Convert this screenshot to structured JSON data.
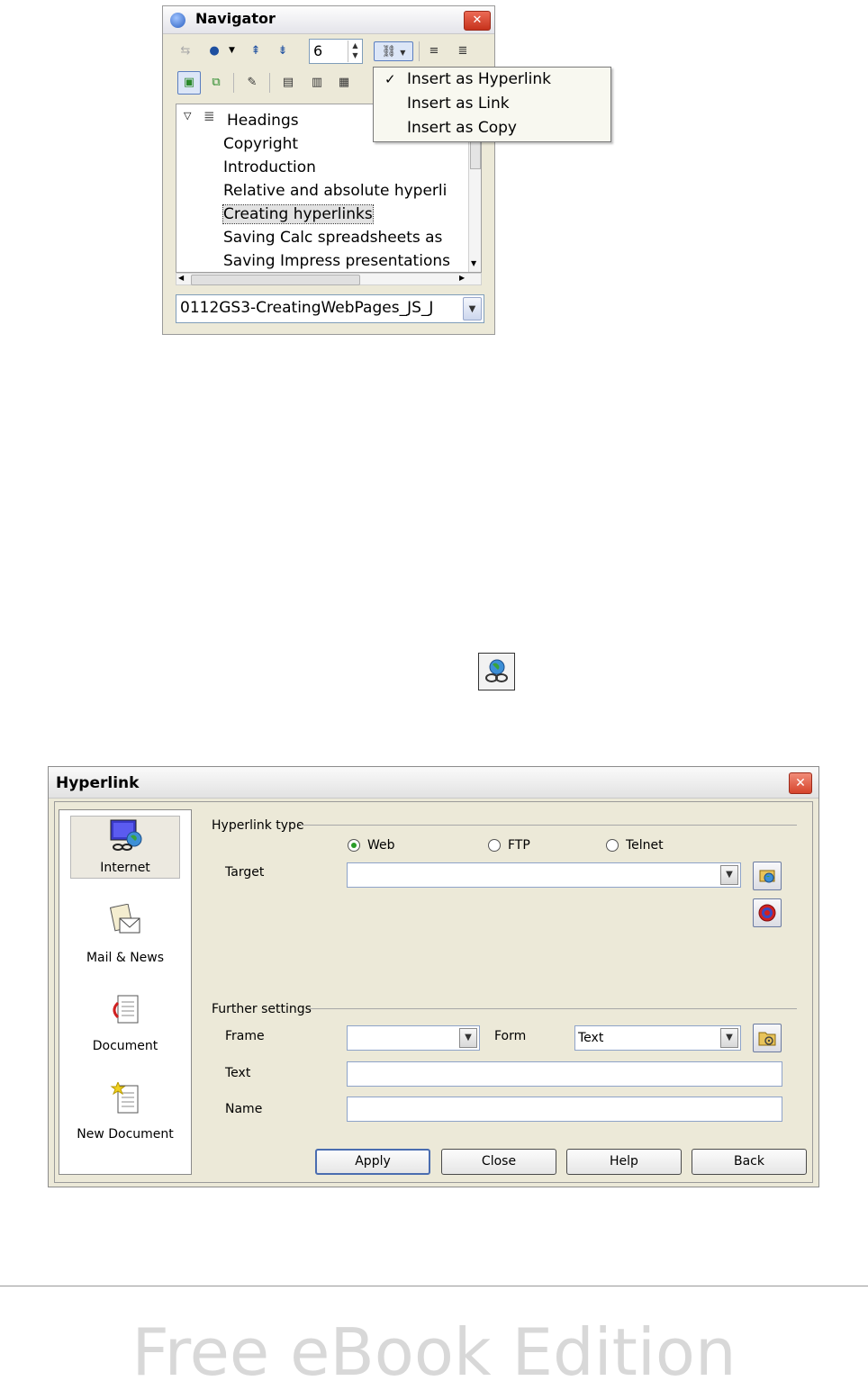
{
  "navigator": {
    "title": "Navigator",
    "close_glyph": "✕",
    "heading_level": "6",
    "tree": {
      "root": "Headings",
      "items": [
        "Copyright",
        "Introduction",
        "Relative and absolute hyperli",
        "Creating hyperlinks",
        "Saving Calc spreadsheets as",
        "Saving Impress presentations"
      ],
      "selected_index": 3
    },
    "document": "0112GS3-CreatingWebPages_JS_J"
  },
  "drag_mode_menu": {
    "items": [
      "Insert as Hyperlink",
      "Insert as Link",
      "Insert as Copy"
    ],
    "checked_index": 0
  },
  "hyperlink_dialog": {
    "title": "Hyperlink",
    "close_glyph": "✕",
    "sidebar": [
      {
        "label": "Internet",
        "icon": "internet-icon",
        "selected": true
      },
      {
        "label": "Mail & News",
        "icon": "mail-news-icon",
        "selected": false
      },
      {
        "label": "Document",
        "icon": "document-icon",
        "selected": false
      },
      {
        "label": "New Document",
        "icon": "new-document-icon",
        "selected": false
      }
    ],
    "hyperlink_type": {
      "label": "Hyperlink type",
      "options": [
        "Web",
        "FTP",
        "Telnet"
      ],
      "selected": "Web"
    },
    "target": {
      "label": "Target",
      "value": ""
    },
    "further_settings": {
      "label": "Further settings",
      "frame_label": "Frame",
      "frame_value": "",
      "form_label": "Form",
      "form_value": "Text",
      "text_label": "Text",
      "text_value": "",
      "name_label": "Name",
      "name_value": ""
    },
    "buttons": {
      "apply": "Apply",
      "close": "Close",
      "help": "Help",
      "back": "Back"
    }
  },
  "footer": {
    "watermark": "Free eBook Edition"
  },
  "colors": {
    "dialog_bg": "#ece9d8",
    "close_red": "#d6442c",
    "selection": "#e2e2e2",
    "radio_green": "#2a9d2a"
  }
}
